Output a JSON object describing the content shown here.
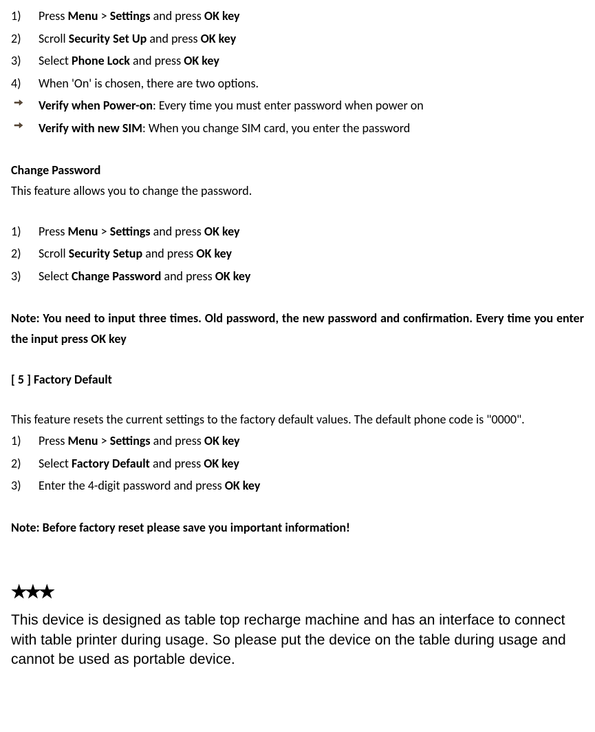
{
  "list1": {
    "items": [
      {
        "num": "1)",
        "parts": [
          "Press ",
          "Menu",
          " > ",
          "Settings",
          " and press ",
          "OK key"
        ]
      },
      {
        "num": "2)",
        "parts": [
          "Scroll ",
          "Security Set Up",
          " and press ",
          "OK key"
        ]
      },
      {
        "num": "3)",
        "parts": [
          "Select ",
          "Phone Lock",
          " and press ",
          "OK key"
        ]
      },
      {
        "num": "4)",
        "plain": "When 'On' is chosen, there are two options."
      }
    ]
  },
  "bullets1": [
    {
      "bold": "Verify when Power-on",
      "rest": ": Every time you must enter password when power on"
    },
    {
      "bold": "Verify with new SIM",
      "rest": ": When you change SIM card, you enter the password"
    }
  ],
  "changePassword": {
    "title": "Change Password",
    "desc": "This feature allows you to change the password."
  },
  "list2": {
    "items": [
      {
        "num": "1)",
        "parts": [
          "Press ",
          "Menu",
          " > ",
          "Settings",
          " and press ",
          "OK key"
        ]
      },
      {
        "num": "2)",
        "parts": [
          "Scroll ",
          "Security Setup",
          " and press ",
          "OK key"
        ]
      },
      {
        "num": "3)",
        "parts": [
          "Select ",
          "Change Password",
          " and press ",
          "OK key"
        ]
      }
    ]
  },
  "note1": "Note: You need to input three times. Old password, the new password and confirmation. Every time you enter the input press OK key",
  "section5": {
    "label": "[ 5 ]    Factory Default",
    "desc": "This feature resets the current settings to the factory default values. The default phone code is \"0000\"."
  },
  "list3": {
    "items": [
      {
        "num": "1)",
        "parts": [
          "Press ",
          "Menu",
          " > ",
          "Settings",
          " and press ",
          "OK key"
        ]
      },
      {
        "num": "2)",
        "parts": [
          "Select ",
          "Factory Default",
          " and press ",
          "OK key"
        ]
      },
      {
        "num": "3)",
        "parts": [
          "Enter the 4-digit password and press ",
          "OK key"
        ]
      }
    ]
  },
  "note2": "Note: Before factory reset please save you important information!",
  "stars": "★★★",
  "footer": "This device is designed as table top recharge machine and has an interface to connect with table printer during usage. So please put the device on the table during usage and cannot be used as portable device."
}
